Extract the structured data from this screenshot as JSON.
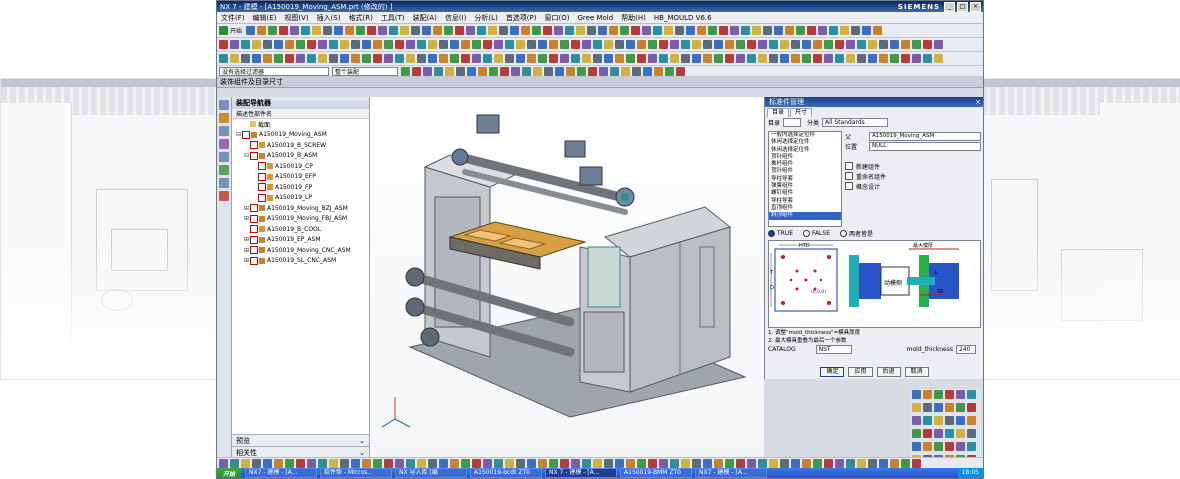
{
  "window": {
    "title": "NX 7 - 建模 - [A150019_Moving_ASM.prt  (修改的) ]",
    "brand": "SIEMENS",
    "controls": [
      "_",
      "□",
      "×"
    ]
  },
  "menu": [
    "文件(F)",
    "编辑(E)",
    "视图(V)",
    "插入(S)",
    "格式(R)",
    "工具(T)",
    "装配(A)",
    "信息(I)",
    "分析(L)",
    "首选项(P)",
    "窗口(O)",
    "Gree Mold",
    "帮助(H)",
    "HB_MOULD V6.6"
  ],
  "toolbar": {
    "start_label": "开始",
    "filter_label": "没有选择过滤器",
    "assembly_combo": "整个装配"
  },
  "dock_header": "装饰组件及目录尺寸",
  "navigator": {
    "title": "装配导航器",
    "column_header": "描述性部件名",
    "items": [
      {
        "label": "截面",
        "indent": 1,
        "expand": "",
        "kind": "folder"
      },
      {
        "label": "A150019_Moving_ASM",
        "indent": 0,
        "expand": "⊟",
        "kind": "assembly"
      },
      {
        "label": "A150019_B_SCREW",
        "indent": 1,
        "expand": "",
        "kind": "part"
      },
      {
        "label": "A150019_B_ASM",
        "indent": 1,
        "expand": "⊟",
        "kind": "assembly"
      },
      {
        "label": "A150019_CP",
        "indent": 2,
        "expand": "",
        "kind": "part"
      },
      {
        "label": "A150019_EFP",
        "indent": 2,
        "expand": "",
        "kind": "part"
      },
      {
        "label": "A150019_FP",
        "indent": 2,
        "expand": "",
        "kind": "part"
      },
      {
        "label": "A150019_LP",
        "indent": 2,
        "expand": "",
        "kind": "part"
      },
      {
        "label": "A150019_Moving_BZJ_ASM",
        "indent": 1,
        "expand": "⊞",
        "kind": "assembly"
      },
      {
        "label": "A150019_Moving_FBJ_ASM",
        "indent": 1,
        "expand": "⊞",
        "kind": "assembly"
      },
      {
        "label": "A150019_B_COOL",
        "indent": 1,
        "expand": "",
        "kind": "part"
      },
      {
        "label": "A150019_EP_ASM",
        "indent": 1,
        "expand": "⊞",
        "kind": "assembly"
      },
      {
        "label": "A150019_Moving_CNC_ASM",
        "indent": 1,
        "expand": "⊞",
        "kind": "assembly"
      },
      {
        "label": "A150019_SL_CNC_ASM",
        "indent": 1,
        "expand": "⊞",
        "kind": "assembly"
      }
    ],
    "sections": [
      {
        "label": "预览"
      },
      {
        "label": "相关性"
      }
    ]
  },
  "dialog": {
    "title": "标准件管理",
    "tabs": [
      "目录",
      "尺寸"
    ],
    "folder_label": "目录",
    "category_label": "分类",
    "category_value": "All Standards",
    "categories": [
      "一般内选择定位件",
      "休闲选择定位件",
      "休闲选择定位件",
      "顶针组件",
      "推杆组件",
      "顶针组件",
      "导柱导套",
      "弹簧组件",
      "螺钉组件",
      "导柱导套",
      "直顶组件",
      "斜顶组件"
    ],
    "selected_category_index": 11,
    "parent_label": "父",
    "parent_value": "A150019_Moving_ASM",
    "position_label": "位置",
    "position_value": "NULL",
    "checkboxes": [
      {
        "label": "新建组件",
        "checked": false
      },
      {
        "label": "重命名组件",
        "checked": false
      },
      {
        "label": "概念设计",
        "checked": false
      }
    ],
    "radios": [
      {
        "label": "TRUE",
        "on": true
      },
      {
        "label": "FALSE",
        "on": false
      },
      {
        "label": "两者皆是",
        "on": false
      }
    ],
    "drawing": {
      "htd": "HTD",
      "max_open": "最大模厚",
      "moving_side": "动模侧",
      "l": "L",
      "sr": "SR",
      "t": "T",
      "d": "D",
      "origin": "(0,0,0)"
    },
    "notes": [
      "1. 调整\"mold_thickness\"=模具厚度",
      "2. 最大模具重叠为最后一个参数"
    ],
    "catalog_label": "CATALOG",
    "catalog_value": "NST",
    "thickness_label": "mold_thickness",
    "thickness_value": "240",
    "buttons": [
      "确定",
      "应用",
      "后退",
      "取消"
    ]
  },
  "taskbar": {
    "start": "开始",
    "items": [
      "NX7 - 建模 - [A...",
      "软件帮 - Micros...",
      "NX 导入库 [编",
      "A150019-bcdt ZT0",
      "NX 7 - 建模 - [A...",
      "A150019-BMM ZT0",
      "NX7 - 建模 - [A..."
    ],
    "clock": "18:05"
  },
  "colors": {
    "title_gradient": "#0a246a",
    "selection": "#3163c5",
    "accent_orange": "#d89a27",
    "check_red": "#cc0000"
  }
}
